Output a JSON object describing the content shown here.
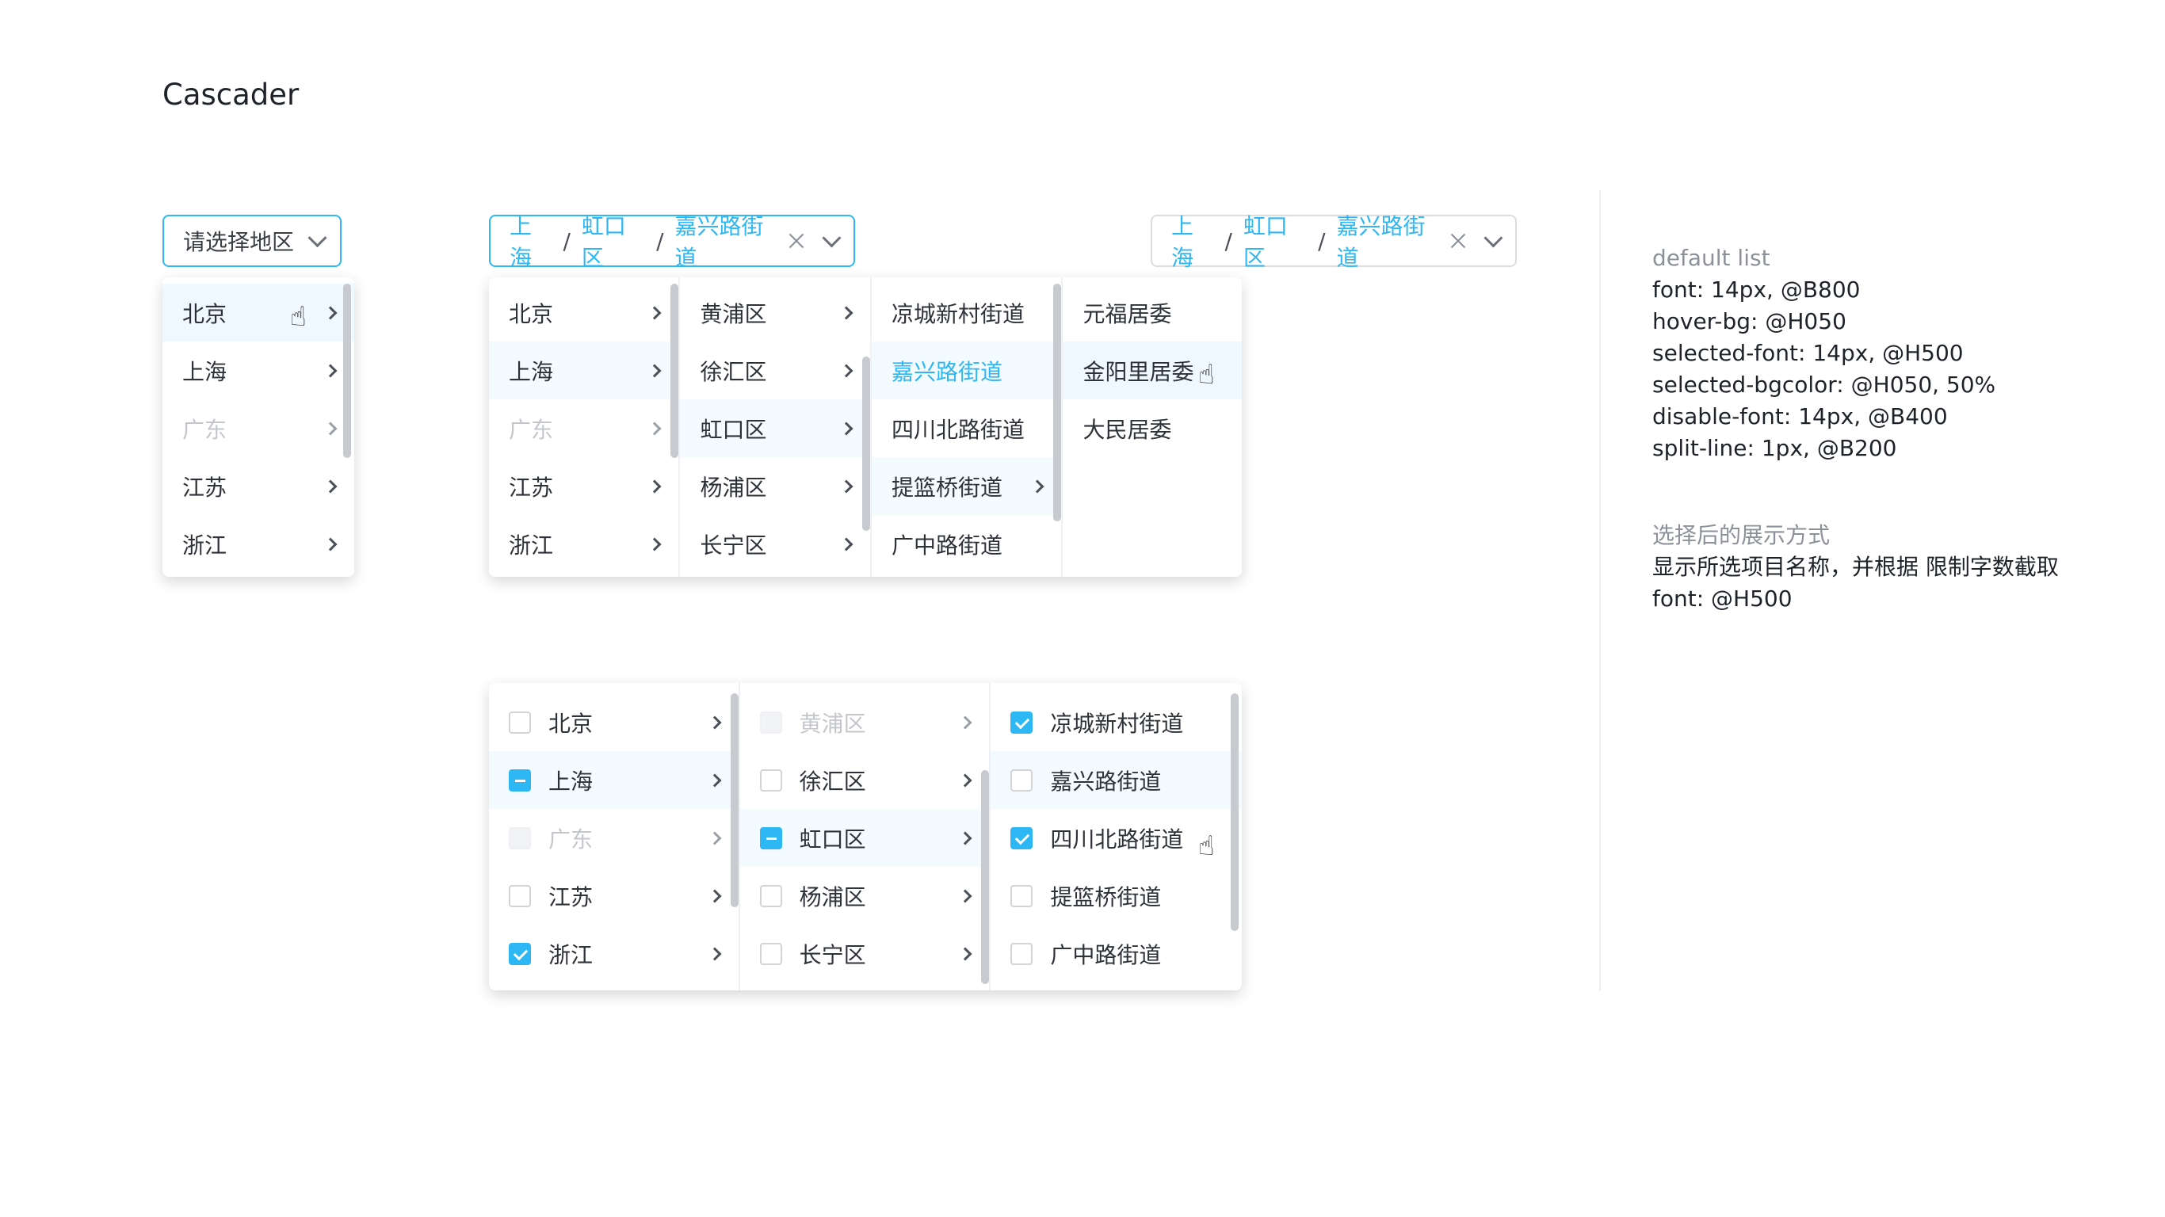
{
  "title": "Cascader",
  "placeholder": "请选择地区",
  "path": [
    "上海",
    "虹口区",
    "嘉兴路街道"
  ],
  "separator": "/",
  "provinces": [
    "北京",
    "上海",
    "广东",
    "江苏",
    "浙江"
  ],
  "districts": [
    "黄浦区",
    "徐汇区",
    "虹口区",
    "杨浦区",
    "长宁区"
  ],
  "streets": [
    "凉城新村街道",
    "嘉兴路街道",
    "四川北路街道",
    "提篮桥街道",
    "广中路街道"
  ],
  "committees": [
    "元福居委",
    "金阳里居委",
    "大民居委"
  ],
  "spec": {
    "heading1": "default list",
    "lines1": [
      "font: 14px, @B800",
      "hover-bg: @H050",
      "selected-font: 14px, @H500",
      "selected-bgcolor: @H050, 50%",
      "disable-font: 14px, @B400",
      "split-line: 1px, @B200"
    ],
    "heading2": "选择后的展示方式",
    "lines2": [
      "显示所选项目名称，并根据 限制字数截取",
      "font: @H500"
    ]
  },
  "colors": {
    "primary": "#2db7f5",
    "hover_bg": "#eef8fe",
    "disabled": "#c3c7cc"
  }
}
